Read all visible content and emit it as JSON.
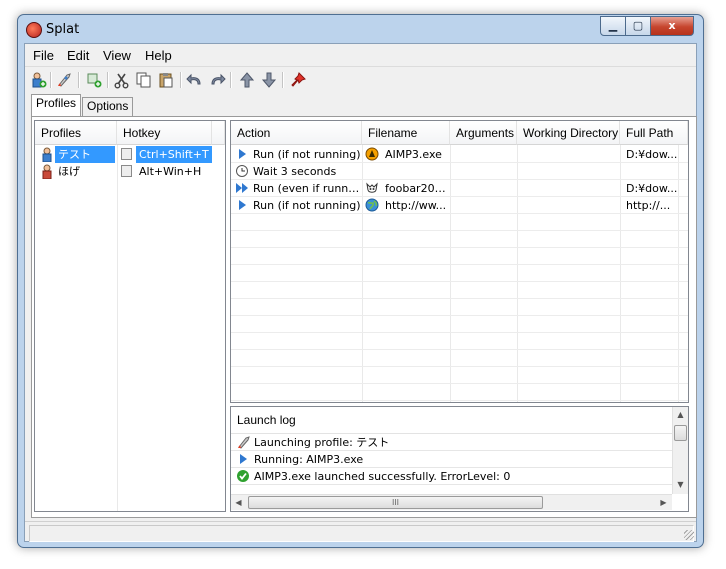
{
  "window": {
    "title": "Splat",
    "close_glyph": "x",
    "minimize_glyph": "▁",
    "maximize_glyph": "▢"
  },
  "menu": [
    "File",
    "Edit",
    "View",
    "Help"
  ],
  "toolbar": {
    "icons": [
      "add-profile-icon",
      "launch-icon",
      "add-action-icon",
      "cut-icon",
      "copy-icon",
      "paste-icon",
      "undo-icon",
      "redo-icon",
      "move-up-icon",
      "move-down-icon",
      "pin-icon"
    ]
  },
  "tabs": [
    {
      "label": "Profiles",
      "active": true
    },
    {
      "label": "Options",
      "active": false
    }
  ],
  "profiles": {
    "columns": [
      "Profiles",
      "Hotkey"
    ],
    "rows": [
      {
        "name": "テスト",
        "hotkey": "Ctrl+Shift+T",
        "selected": true
      },
      {
        "name": "ほげ",
        "hotkey": "Alt+Win+H",
        "selected": false
      }
    ]
  },
  "actions": {
    "columns": [
      "Action",
      "Filename",
      "Arguments",
      "Working Directory",
      "Full Path"
    ],
    "rows": [
      {
        "action": "Run (if not running)",
        "action_icon": "play-icon",
        "filename": "AIMP3.exe",
        "file_icon": "aimp-icon",
        "arguments": "",
        "workdir": "",
        "fullpath": "D:¥dow..."
      },
      {
        "action": "Wait 3 seconds",
        "action_icon": "clock-icon",
        "filename": "",
        "file_icon": "",
        "arguments": "",
        "workdir": "",
        "fullpath": ""
      },
      {
        "action": "Run (even if runnin...",
        "action_icon": "fast-forward-icon",
        "filename": "foobar200...",
        "file_icon": "foobar-icon",
        "arguments": "",
        "workdir": "",
        "fullpath": "D:¥dow..."
      },
      {
        "action": "Run (if not running)",
        "action_icon": "play-icon",
        "filename": "http://ww...",
        "file_icon": "globe-icon",
        "arguments": "",
        "workdir": "",
        "fullpath": "http://..."
      }
    ]
  },
  "log": {
    "title": "Launch log",
    "entries": [
      {
        "icon": "launch-icon",
        "text": "Launching profile: テスト"
      },
      {
        "icon": "play-icon",
        "text": "Running: AIMP3.exe"
      },
      {
        "icon": "check-icon",
        "text": "AIMP3.exe launched successfully.  ErrorLevel: 0"
      }
    ],
    "hscroll_grip": "III"
  },
  "status": {
    "text": ""
  }
}
